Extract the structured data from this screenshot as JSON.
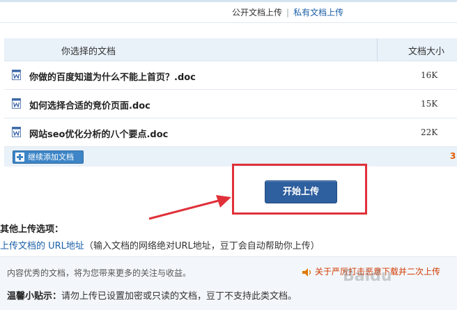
{
  "tabs": {
    "public": "公开文档上传",
    "separator": "|",
    "private": "私有文档上传"
  },
  "table": {
    "header_name": "你选择的文档",
    "header_size": "文档大小",
    "files": [
      {
        "name": "你做的百度知道为什么不能上首页？.doc",
        "size": "16K"
      },
      {
        "name": "如何选择合适的竞价页面.doc",
        "size": "15K"
      },
      {
        "name": "网站seo优化分析的八个要点.doc",
        "size": "22K"
      }
    ],
    "add_button": "继续添加文档",
    "count": "3"
  },
  "start_button": "开始上传",
  "other_options": {
    "title": "其他上传选项：",
    "link": "上传文档的 URL地址",
    "description": "（输入文档的网络绝对URL地址，豆丁会自动帮助你上传）"
  },
  "footer": {
    "promo": "内容优秀的文档，将为您带来更多的关注与收益。",
    "notice": "关于严厉打击恶意下载并二次上传",
    "tip_label": "温馨小贴示：",
    "tip_text": "请勿上传已设置加密或只读的文档，豆丁不支持此类文档。"
  },
  "watermark": "Baidu",
  "colors": {
    "accent": "#2e5f9e",
    "link": "#1a5fa6",
    "highlight": "#e0313a",
    "notice": "#d23a00"
  }
}
